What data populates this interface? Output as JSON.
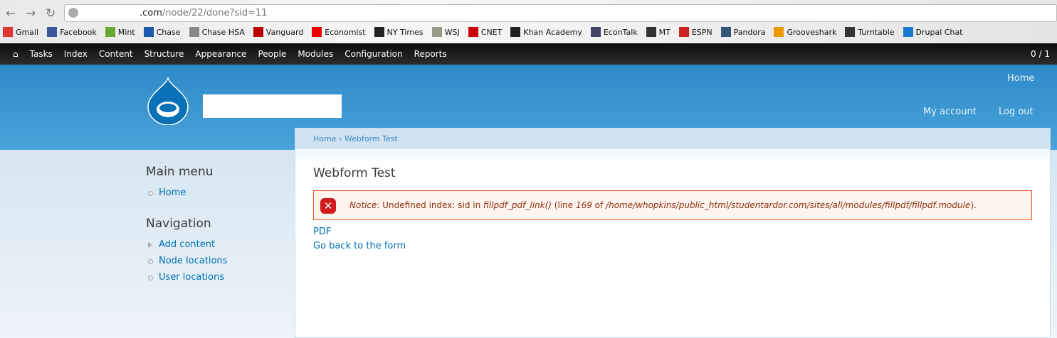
{
  "browser": {
    "url_host": ".com",
    "url_path": "/node/22/done?sid=11",
    "bookmarks": [
      {
        "label": "Gmail",
        "color": "#d33"
      },
      {
        "label": "Facebook",
        "color": "#3b5998"
      },
      {
        "label": "Mint",
        "color": "#6a3"
      },
      {
        "label": "Chase",
        "color": "#1a5aa8"
      },
      {
        "label": "Chase HSA",
        "color": "#888"
      },
      {
        "label": "Vanguard",
        "color": "#b00"
      },
      {
        "label": "Economist",
        "color": "#e00"
      },
      {
        "label": "NY Times",
        "color": "#222"
      },
      {
        "label": "WSJ",
        "color": "#998"
      },
      {
        "label": "CNET",
        "color": "#c00"
      },
      {
        "label": "Khan Academy",
        "color": "#222"
      },
      {
        "label": "EconTalk",
        "color": "#446"
      },
      {
        "label": "MT",
        "color": "#333"
      },
      {
        "label": "ESPN",
        "color": "#c22"
      },
      {
        "label": "Pandora",
        "color": "#357"
      },
      {
        "label": "Grooveshark",
        "color": "#e90"
      },
      {
        "label": "Turntable",
        "color": "#333"
      },
      {
        "label": "Drupal Chat",
        "color": "#1a7ad0"
      }
    ]
  },
  "toolbar": {
    "items": [
      "Tasks",
      "Index",
      "Content",
      "Structure",
      "Appearance",
      "People",
      "Modules",
      "Configuration",
      "Reports"
    ],
    "count": "0 / 1"
  },
  "header": {
    "home": "Home",
    "my_account": "My account",
    "logout": "Log out"
  },
  "breadcrumb": {
    "home": "Home",
    "sep": "›",
    "current": "Webform Test"
  },
  "sidebar": {
    "main_menu": "Main menu",
    "main_items": [
      "Home"
    ],
    "navigation": "Navigation",
    "nav_items": [
      "Add content",
      "Node locations",
      "User locations"
    ]
  },
  "page": {
    "title": "Webform Test",
    "notice": {
      "label": "Notice",
      "text1": ": Undefined index: sid in ",
      "func": "fillpdf_pdf_link()",
      "text2": " (line ",
      "line": "169",
      "text3": " of ",
      "path": "/home/whopkins/public_html/studentardor.com/sites/all/modules/fillpdf/fillpdf.module",
      "text4": ")."
    },
    "links": [
      "PDF",
      "Go back to the form"
    ]
  }
}
